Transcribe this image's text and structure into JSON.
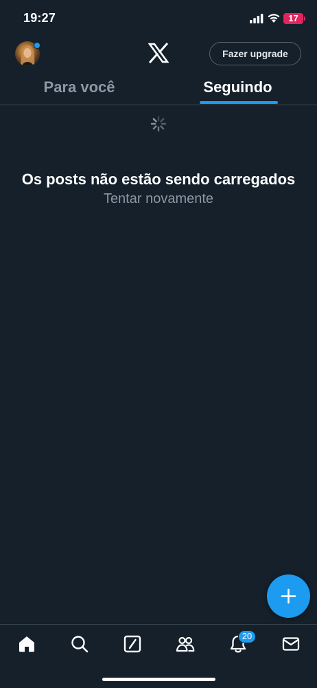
{
  "status_bar": {
    "time": "19:27",
    "battery": "17"
  },
  "header": {
    "upgrade_label": "Fazer upgrade"
  },
  "tabs": [
    {
      "label": "Para você",
      "active": false
    },
    {
      "label": "Seguindo",
      "active": true
    }
  ],
  "feed": {
    "error_title": "Os posts não estão sendo carregados",
    "retry_label": "Tentar novamente"
  },
  "bottom_nav": {
    "notifications_badge": "20"
  },
  "colors": {
    "background": "#15202b",
    "accent": "#1d9bf0",
    "battery": "#e0245e",
    "muted_text": "#8b98a5"
  },
  "icons": [
    "avatar",
    "x-logo-icon",
    "loading-spinner",
    "compose-plus-icon",
    "home-icon",
    "search-icon",
    "grok-icon",
    "communities-icon",
    "bell-icon",
    "mail-icon"
  ]
}
